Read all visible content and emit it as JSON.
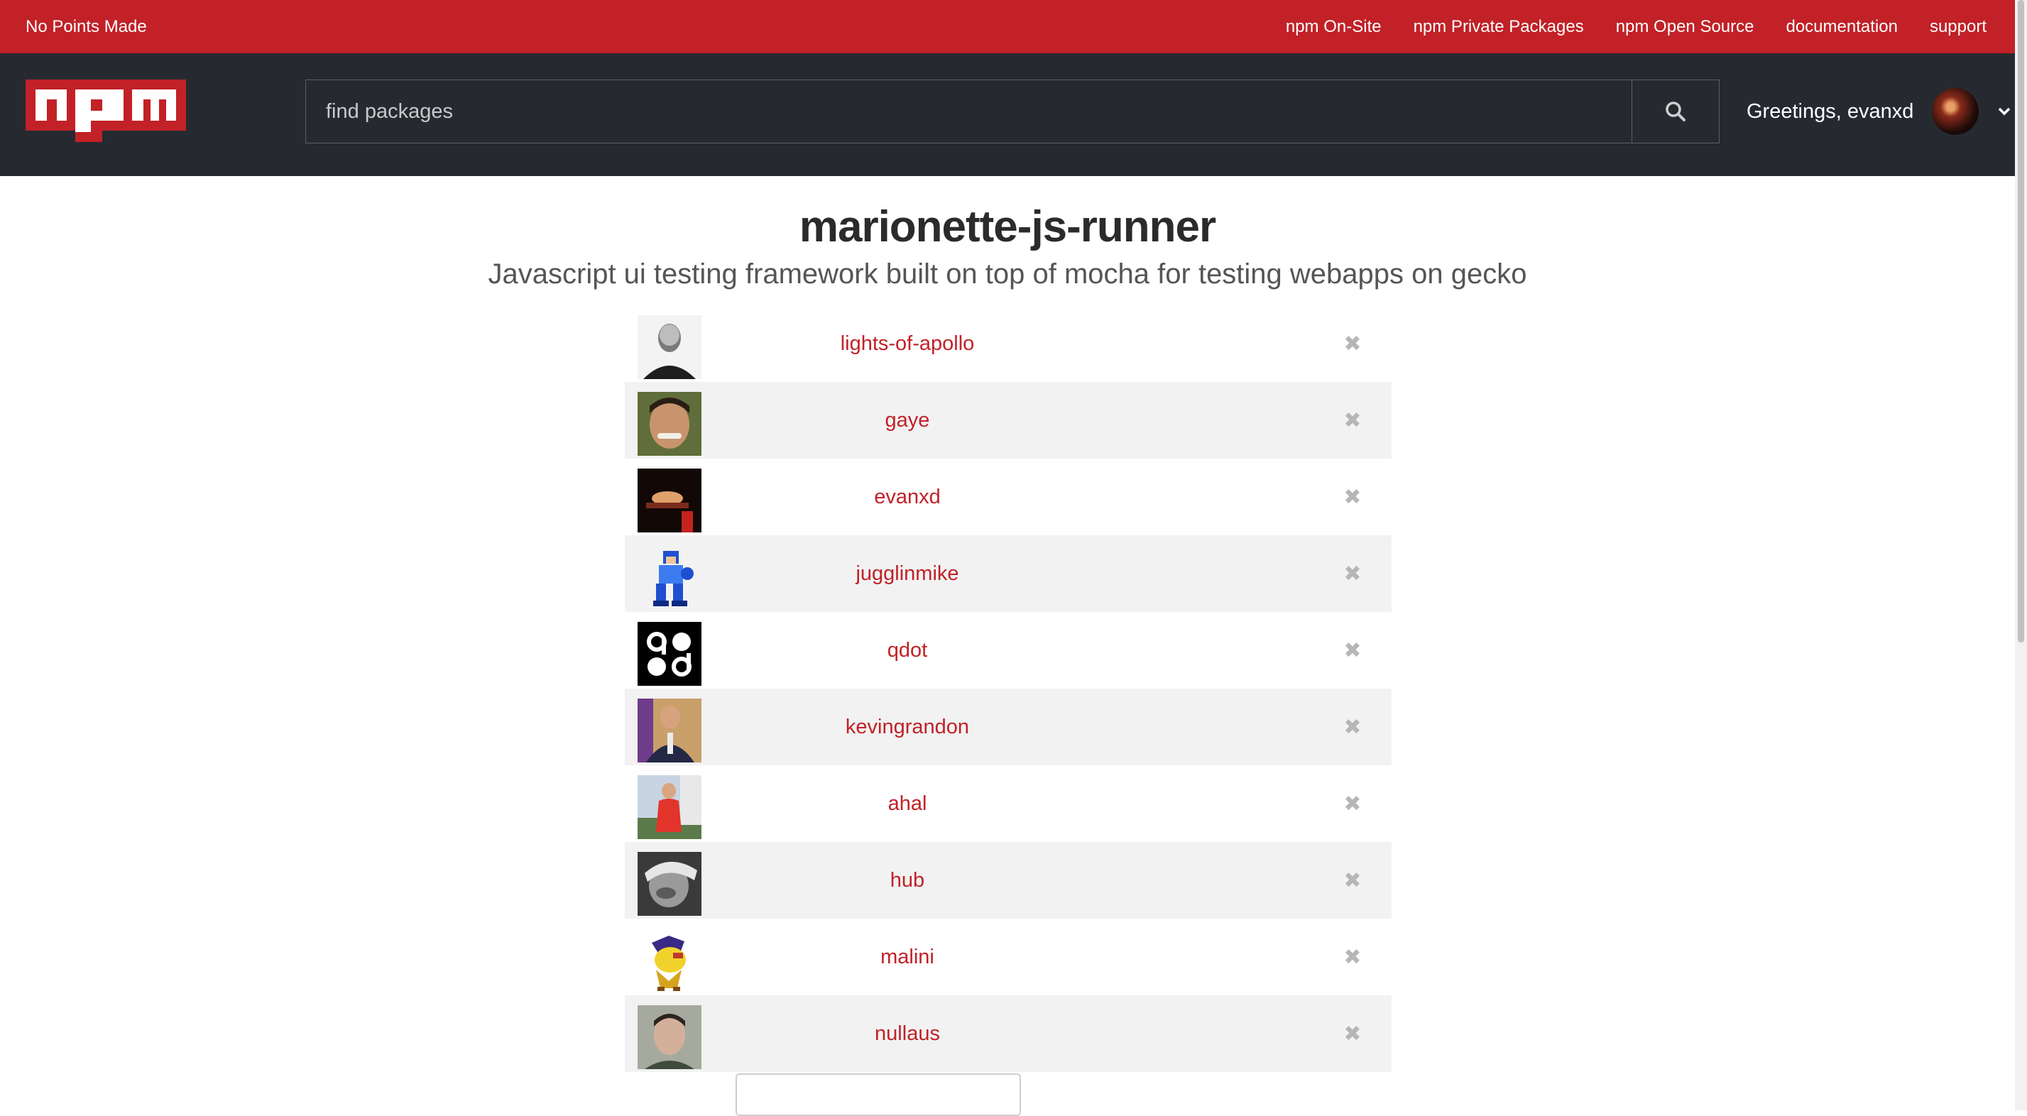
{
  "topbar": {
    "tagline": "No Points Made",
    "links": [
      "npm On-Site",
      "npm Private Packages",
      "npm Open Source",
      "documentation",
      "support"
    ]
  },
  "header": {
    "logo_text": "npm",
    "search_placeholder": "find packages",
    "search_icon": "search-icon",
    "greeting": "Greetings, evanxd",
    "menu_icon": "chevron-down-icon"
  },
  "package": {
    "name": "marionette-js-runner",
    "description": "Javascript ui testing framework built on top of mocha for testing webapps on gecko"
  },
  "collaborators": [
    {
      "name": "lights-of-apollo",
      "remove": "✖"
    },
    {
      "name": "gaye",
      "remove": "✖"
    },
    {
      "name": "evanxd",
      "remove": "✖"
    },
    {
      "name": "jugglinmike",
      "remove": "✖"
    },
    {
      "name": "qdot",
      "remove": "✖"
    },
    {
      "name": "kevingrandon",
      "remove": "✖"
    },
    {
      "name": "ahal",
      "remove": "✖"
    },
    {
      "name": "hub",
      "remove": "✖"
    },
    {
      "name": "malini",
      "remove": "✖"
    },
    {
      "name": "nullaus",
      "remove": "✖"
    }
  ],
  "colors": {
    "brand_red": "#c12127",
    "header_dark": "#262a30"
  }
}
